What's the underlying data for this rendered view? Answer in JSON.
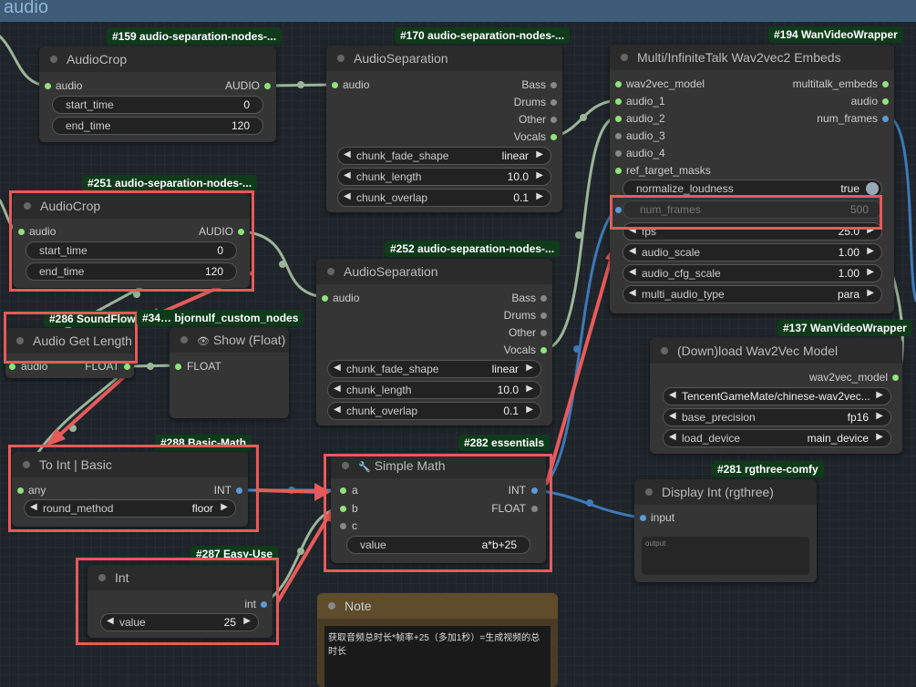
{
  "group": {
    "title": "audio"
  },
  "nodes": {
    "n159": {
      "badge": "#159 audio-separation-nodes-...",
      "title": "AudioCrop",
      "in_audio": "audio",
      "out_audio": "AUDIO",
      "w1_label": "start_time",
      "w1_value": "0",
      "w2_label": "end_time",
      "w2_value": "120"
    },
    "n170": {
      "badge": "#170 audio-separation-nodes-...",
      "title": "AudioSeparation",
      "in_audio": "audio",
      "out1": "Bass",
      "out2": "Drums",
      "out3": "Other",
      "out4": "Vocals",
      "w1_label": "chunk_fade_shape",
      "w1_value": "linear",
      "w2_label": "chunk_length",
      "w2_value": "10.0",
      "w3_label": "chunk_overlap",
      "w3_value": "0.1"
    },
    "n194": {
      "badge": "#194 WanVideoWrapper",
      "title": "Multi/InfiniteTalk Wav2vec2 Embeds",
      "in1": "wav2vec_model",
      "in2": "audio_1",
      "in3": "audio_2",
      "in4": "audio_3",
      "in5": "audio_4",
      "in6": "ref_target_masks",
      "out1": "multitalk_embeds",
      "out2": "audio",
      "out3": "num_frames",
      "t_label": "normalize_loudness",
      "t_value": "true",
      "nf_label": "num_frames",
      "nf_value": "500",
      "w1_label": "fps",
      "w1_value": "25.0",
      "w2_label": "audio_scale",
      "w2_value": "1.00",
      "w3_label": "audio_cfg_scale",
      "w3_value": "1.00",
      "w4_label": "multi_audio_type",
      "w4_value": "para"
    },
    "n251": {
      "badge": "#251 audio-separation-nodes-...",
      "title": "AudioCrop",
      "in_audio": "audio",
      "out_audio": "AUDIO",
      "w1_label": "start_time",
      "w1_value": "0",
      "w2_label": "end_time",
      "w2_value": "120"
    },
    "n252": {
      "badge": "#252 audio-separation-nodes-...",
      "title": "AudioSeparation",
      "in_audio": "audio",
      "out1": "Bass",
      "out2": "Drums",
      "out3": "Other",
      "out4": "Vocals",
      "w1_label": "chunk_fade_shape",
      "w1_value": "linear",
      "w2_label": "chunk_length",
      "w2_value": "10.0",
      "w3_label": "chunk_overlap",
      "w3_value": "0.1"
    },
    "n286": {
      "badge": "#286 SoundFlow",
      "title": "Audio Get Length",
      "in_audio": "audio",
      "out": "FLOAT"
    },
    "n34x": {
      "badge": "#34… bjornulf_custom_nodes",
      "title": "Show (Float)",
      "in": "FLOAT"
    },
    "n137": {
      "badge": "#137 WanVideoWrapper",
      "title": "(Down)load Wav2Vec Model",
      "out": "wav2vec_model",
      "w1_value": "TencentGameMate/chinese-wav2vec...",
      "w2_label": "base_precision",
      "w2_value": "fp16",
      "w3_label": "load_device",
      "w3_value": "main_device"
    },
    "n288": {
      "badge": "#288 Basic-Math",
      "title": "To Int | Basic",
      "in": "any",
      "out": "INT",
      "w1_label": "round_method",
      "w1_value": "floor"
    },
    "n282": {
      "badge": "#282 essentials",
      "title": "Simple Math",
      "in1": "a",
      "in2": "b",
      "in3": "c",
      "out1": "INT",
      "out2": "FLOAT",
      "w1_label": "value",
      "w1_value": "a*b+25"
    },
    "n281": {
      "badge": "#281 rgthree-comfy",
      "title": "Display Int (rgthree)",
      "in": "input",
      "text": "output"
    },
    "n287": {
      "badge": "#287 Easy-Use",
      "title": "Int",
      "out": "int",
      "w1_label": "value",
      "w1_value": "25"
    },
    "note": {
      "title": "Note",
      "text": "获取音频总时长*帧率+25（多加1秒）=生成视频的总时长"
    }
  },
  "glyphs": {
    "left_arrow": "◀",
    "right_arrow": "▶",
    "eye": "👁",
    "wrench": "🔧"
  }
}
